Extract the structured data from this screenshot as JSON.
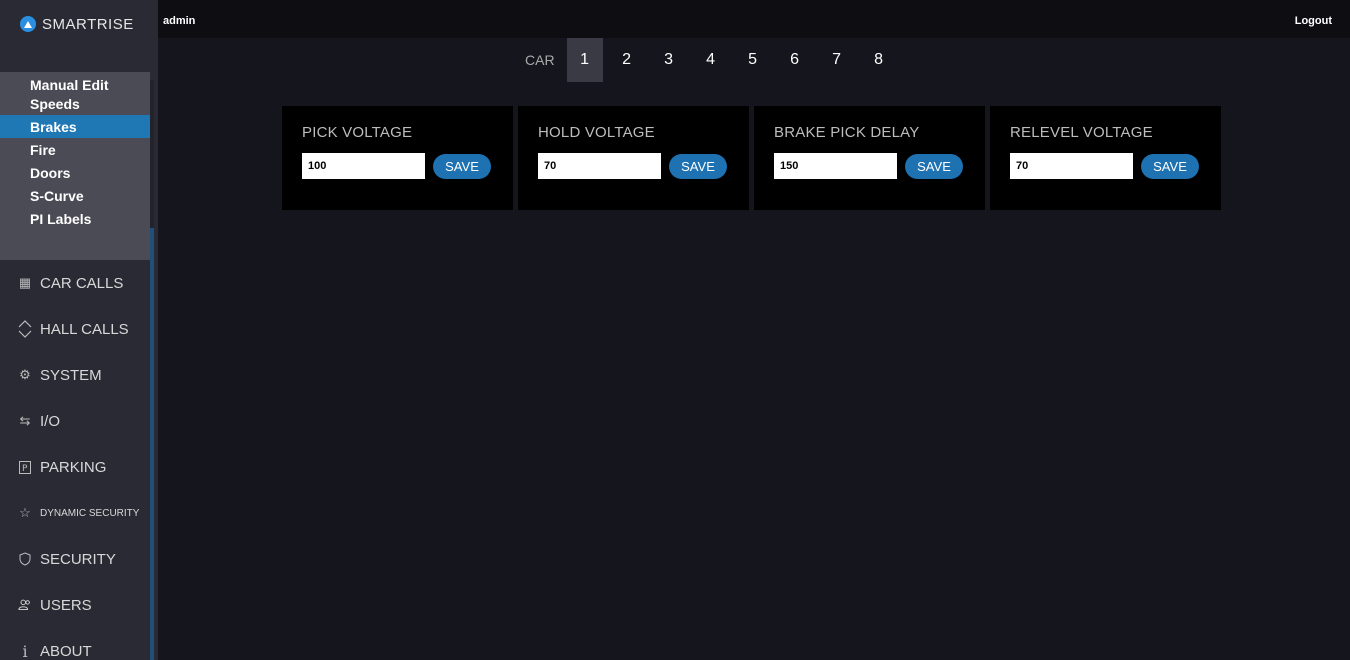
{
  "app": {
    "brand": "SMARTRISE"
  },
  "topbar": {
    "user": "admin",
    "logout": "Logout"
  },
  "submenu": [
    {
      "label": "Manual Edit",
      "active": false
    },
    {
      "label": "Speeds",
      "active": false
    },
    {
      "label": "Brakes",
      "active": true
    },
    {
      "label": "Fire",
      "active": false
    },
    {
      "label": "Doors",
      "active": false
    },
    {
      "label": "S-Curve",
      "active": false
    },
    {
      "label": "PI Labels",
      "active": false
    }
  ],
  "nav": [
    {
      "label": "CAR CALLS",
      "icon": "car-calls-icon"
    },
    {
      "label": "HALL CALLS",
      "icon": "hall-calls-icon"
    },
    {
      "label": "SYSTEM",
      "icon": "gear-icon"
    },
    {
      "label": "I/O",
      "icon": "swap-arrows-icon"
    },
    {
      "label": "PARKING",
      "icon": "parking-icon"
    },
    {
      "label": "DYNAMIC SECURITY",
      "icon": "star-icon"
    },
    {
      "label": "SECURITY",
      "icon": "shield-icon"
    },
    {
      "label": "USERS",
      "icon": "users-icon"
    },
    {
      "label": "ABOUT",
      "icon": "info-icon"
    }
  ],
  "cars": {
    "label": "CAR",
    "tabs": [
      "1",
      "2",
      "3",
      "4",
      "5",
      "6",
      "7",
      "8"
    ],
    "active": "1"
  },
  "cards": [
    {
      "title": "PICK VOLTAGE",
      "value": "100",
      "save": "SAVE"
    },
    {
      "title": "HOLD VOLTAGE",
      "value": "70",
      "save": "SAVE"
    },
    {
      "title": "BRAKE PICK DELAY",
      "value": "150",
      "save": "SAVE"
    },
    {
      "title": "RELEVEL VOLTAGE",
      "value": "70",
      "save": "SAVE"
    }
  ],
  "colors": {
    "accent": "#1e72b2",
    "sidebar": "#2a2a34",
    "background": "#15151d"
  }
}
